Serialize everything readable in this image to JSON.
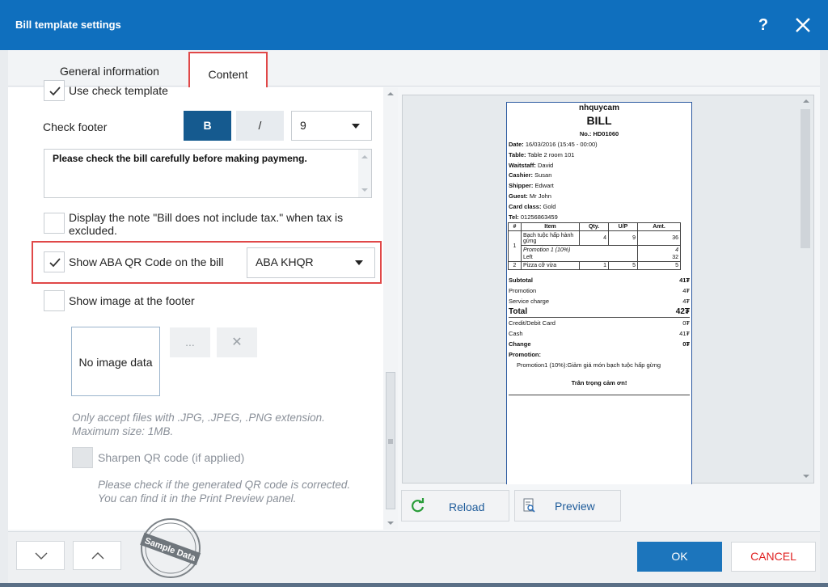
{
  "window": {
    "title": "Bill template settings",
    "help": "?"
  },
  "tabs": [
    {
      "label": "General information"
    },
    {
      "label": "Content"
    }
  ],
  "left": {
    "use_check_template": "Use check template",
    "check_footer_label": "Check footer",
    "bold_label": "B",
    "italic_label": "/",
    "font_size": "9",
    "footer_text": "Please check the bill carefully before making paymeng.",
    "tax_note_line1": "Display the note \"Bill does not include tax.\" when tax is",
    "tax_note_line2": "excluded.",
    "aba_label": "Show ABA QR Code on the bill",
    "aba_select": "ABA KHQR",
    "show_image_label": "Show image at the footer",
    "no_image": "No image data",
    "browse": "...",
    "remove": "✕",
    "hint1": "Only accept files with .JPG, .JPEG, .PNG extension.",
    "hint2": "Maximum size: 1MB.",
    "sharpen_label": "Sharpen QR code (if applied)",
    "hint3": "Please check if the generated QR code is corrected.",
    "hint4": "You can find it in the Print Preview panel."
  },
  "bill": {
    "shop": "nhquycam",
    "title": "BILL",
    "no": "No.: HD01060",
    "date_label": "Date:",
    "date": "16/03/2016 (15:45 - 00:00)",
    "table_label": "Table:",
    "table": "Table 2 room 101",
    "waitstaff_label": "Waitstaff:",
    "waitstaff": "David",
    "cashier_label": "Cashier:",
    "cashier": "Susan",
    "shipper_label": "Shipper:",
    "shipper": "Edwart",
    "guest_label": "Guest:",
    "guest": "Mr John",
    "card_label": "Card class:",
    "card": "Gold",
    "tel_label": "Tel:",
    "tel": "01256863459",
    "headers": [
      "#",
      "Item",
      "Qty.",
      "U/P",
      "Amt."
    ],
    "row1": [
      "1",
      "Bạch tuộc hấp hành gừng",
      "4",
      "9",
      "36"
    ],
    "row1_promo": "Promotion 1 (10%)",
    "row1_promo_val": "4",
    "row1_left": "Left",
    "row1_left_val": "32",
    "row2": [
      "2",
      "Pizza cỡ vừa",
      "1",
      "5",
      "5"
    ],
    "subtotal_label": "Subtotal",
    "subtotal": "41₮",
    "promotion_label": "Promotion",
    "promotion": "4₮",
    "service_label": "Service charge",
    "service": "4₮",
    "total_label": "Total",
    "total": "42₮",
    "credit_label": "Credit/Debit Card",
    "credit": "0₮",
    "cash_label": "Cash",
    "cash": "41₮",
    "change_label": "Change",
    "change": "0₮",
    "promo_title": "Promotion:",
    "promo_detail": "Promotion1 (10%):Giảm giá món bạch tuộc hấp gừng",
    "thanks": "Trân trọng cảm ơn!"
  },
  "actions": {
    "reload": "Reload",
    "preview": "Preview"
  },
  "footer": {
    "ok": "OK",
    "cancel": "CANCEL",
    "stamp": "Sample Data"
  },
  "colors": {
    "titlebar": "#0f6fbe",
    "accent": "#1c75bc",
    "highlight": "#e04848",
    "cancel": "#e02020"
  }
}
